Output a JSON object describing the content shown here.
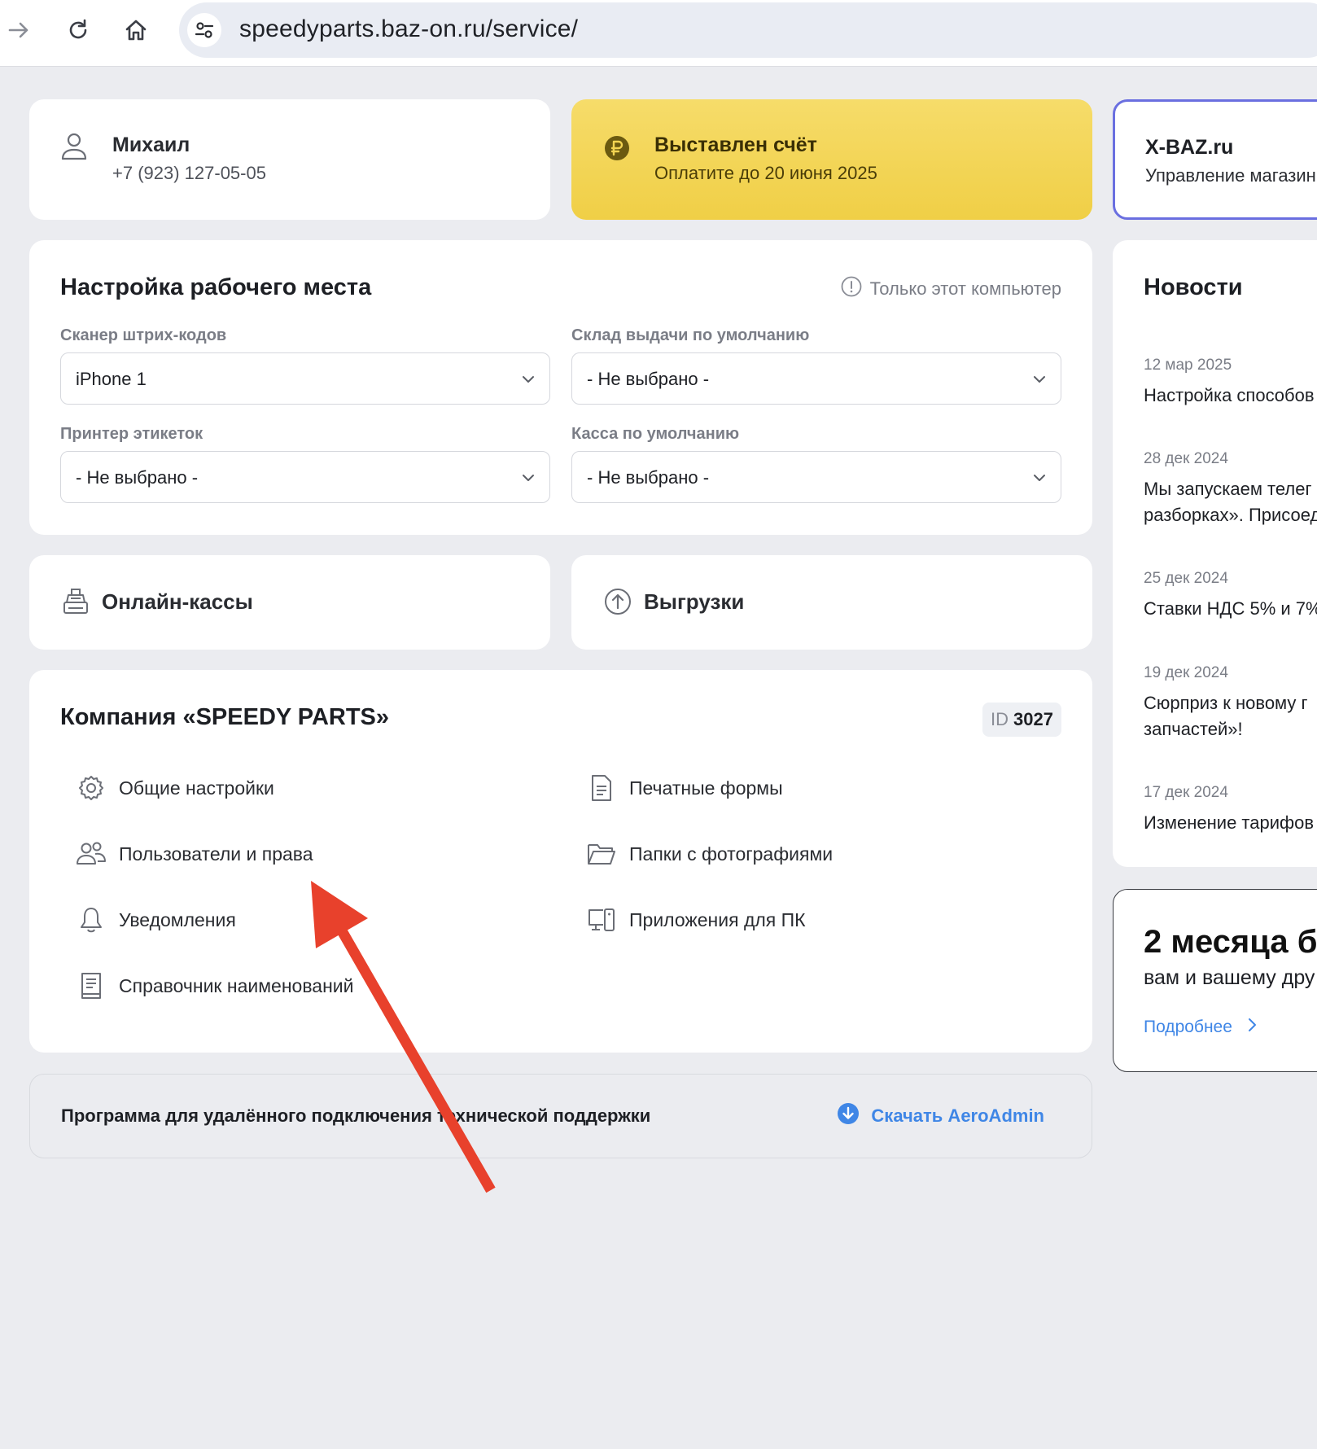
{
  "browser": {
    "url": "speedyparts.baz-on.ru/service/"
  },
  "user": {
    "name": "Михаил",
    "phone": "+7 (923) 127-05-05"
  },
  "billing": {
    "title": "Выставлен счёт",
    "subtitle": "Оплатите до 20 июня 2025"
  },
  "xbaz": {
    "title": "X-BAZ.ru",
    "subtitle": "Управление магазин"
  },
  "workstation": {
    "title": "Настройка рабочего места",
    "note": "Только этот компьютер",
    "fields": [
      {
        "label": "Сканер штрих-кодов",
        "value": "iPhone 1"
      },
      {
        "label": "Склад выдачи по умолчанию",
        "value": "- Не выбрано -"
      },
      {
        "label": "Принтер этикеток",
        "value": "- Не выбрано -"
      },
      {
        "label": "Касса по умолчанию",
        "value": "- Не выбрано -"
      }
    ]
  },
  "tiles": {
    "cash": "Онлайн-кассы",
    "export": "Выгрузки"
  },
  "company": {
    "title": "Компания «SPEEDY PARTS»",
    "id_label": "ID",
    "id_value": "3027",
    "menu": [
      {
        "label": "Общие настройки",
        "icon": "gear-icon"
      },
      {
        "label": "Печатные формы",
        "icon": "document-icon"
      },
      {
        "label": "Пользователи и права",
        "icon": "users-icon"
      },
      {
        "label": "Папки с фотографиями",
        "icon": "folder-icon"
      },
      {
        "label": "Уведомления",
        "icon": "bell-icon"
      },
      {
        "label": "Приложения для ПК",
        "icon": "devices-icon"
      },
      {
        "label": "Справочник наименований",
        "icon": "book-icon"
      }
    ]
  },
  "remote": {
    "text": "Программа для удалённого подключения технической поддержки",
    "link": "Скачать AeroAdmin"
  },
  "news": {
    "title": "Новости",
    "items": [
      {
        "date": "12 мар 2025",
        "text": "Настройка способов"
      },
      {
        "date": "28 дек 2024",
        "text": "Мы запускаем телег\nразборках». Присоед"
      },
      {
        "date": "25 дек 2024",
        "text": "Ставки НДС 5% и 7%"
      },
      {
        "date": "19 дек 2024",
        "text": "Сюрприз к новому г\nзапчастей»!"
      },
      {
        "date": "17 дек 2024",
        "text": "Изменение тарифов"
      }
    ]
  },
  "promo": {
    "title": "2 месяца бе",
    "subtitle": "вам и вашему дру",
    "link": "Подробнее"
  },
  "colors": {
    "background": "#ebecf0",
    "bill_yellow": "#f3d452",
    "link_blue": "#3f86e6",
    "arrow_red": "#e8412c",
    "xbaz_border": "#6a6fe0"
  }
}
